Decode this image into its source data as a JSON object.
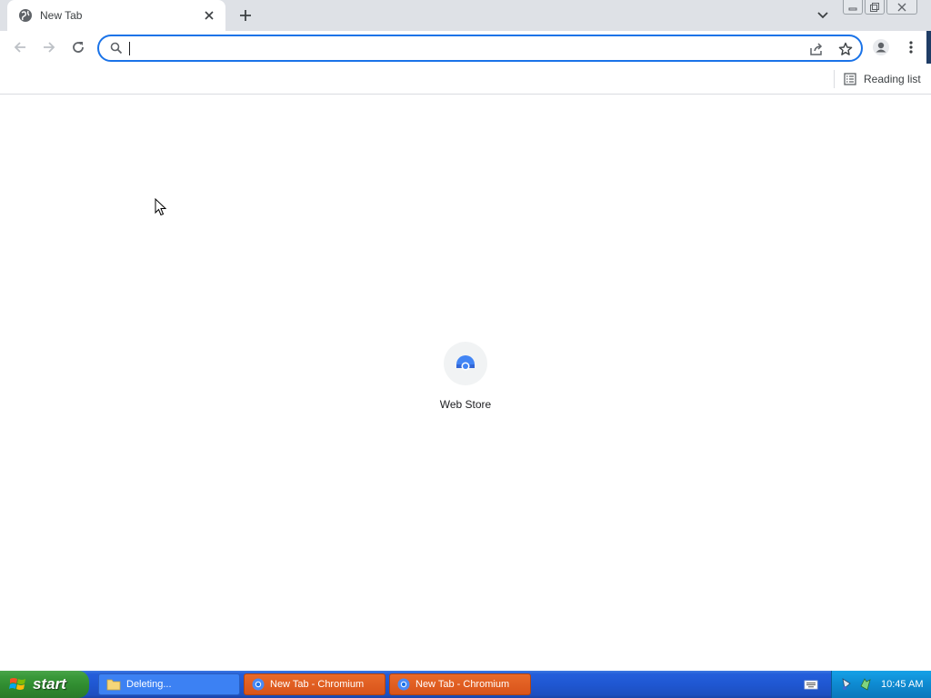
{
  "browser": {
    "tab": {
      "title": "New Tab"
    },
    "omnibox": {
      "value": "",
      "placeholder": ""
    },
    "bookmarks_bar": {
      "reading_list_label": "Reading list"
    },
    "accent_color": "#1a73e8"
  },
  "ntp": {
    "shortcuts": [
      {
        "label": "Web Store",
        "icon": "web-store-icon"
      }
    ]
  },
  "taskbar": {
    "start_label": "start",
    "tasks": [
      {
        "label": "Deleting...",
        "icon": "folder-icon",
        "active": false
      },
      {
        "label": "New Tab - Chromium",
        "icon": "chromium-icon",
        "active": true
      },
      {
        "label": "New Tab - Chromium",
        "icon": "chromium-icon",
        "active": true
      }
    ],
    "clock": "10:45 AM"
  }
}
